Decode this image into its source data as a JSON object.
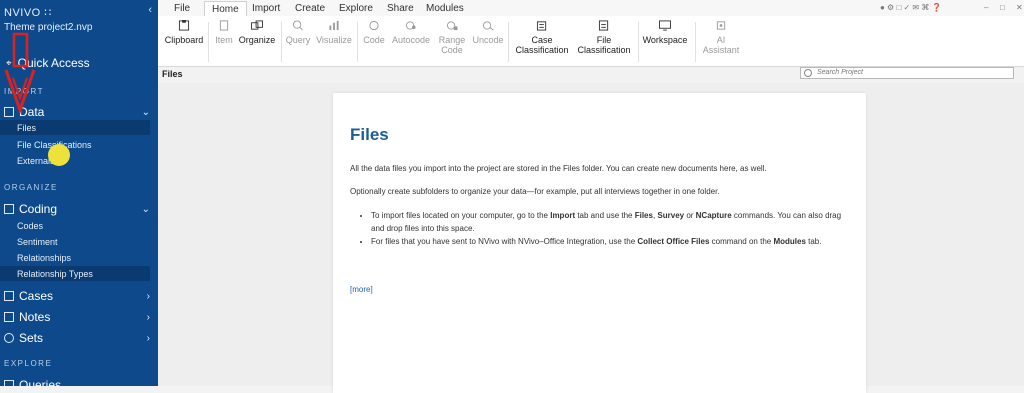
{
  "app": {
    "brand": "NVIVO",
    "project": "Theme project2.nvp"
  },
  "sidebar": {
    "quick_access": "Quick Access",
    "sections": {
      "import": "IMPORT",
      "organize": "ORGANIZE",
      "explore": "EXPLORE"
    },
    "data_group": {
      "label": "Data",
      "items": [
        {
          "label": "Files",
          "active": true
        },
        {
          "label": "File Classifications"
        },
        {
          "label": "Externals"
        }
      ]
    },
    "coding_group": {
      "label": "Coding",
      "items": [
        {
          "label": "Codes"
        },
        {
          "label": "Sentiment"
        },
        {
          "label": "Relationships"
        },
        {
          "label": "Relationship Types"
        }
      ]
    },
    "cases": "Cases",
    "notes": "Notes",
    "sets": "Sets",
    "queries": "Queries"
  },
  "ribbon": {
    "tabs": [
      "File",
      "Home",
      "Import",
      "Create",
      "Explore",
      "Share",
      "Modules"
    ],
    "active_tab": "Home",
    "buttons": {
      "clipboard": "Clipboard",
      "item": "Item",
      "organize": "Organize",
      "query": "Query",
      "visualize": "Visualize",
      "code": "Code",
      "autocode": "Autocode",
      "range_code": [
        "Range",
        "Code"
      ],
      "uncode": "Uncode",
      "case_classification": [
        "Case",
        "Classification"
      ],
      "file_classification": [
        "File",
        "Classification"
      ],
      "workspace": "Workspace",
      "ai_assistant": [
        "AI",
        "Assistant"
      ]
    }
  },
  "header": {
    "title": "Files",
    "search_placeholder": "Search Project"
  },
  "content": {
    "title": "Files",
    "para1": "All the data files you import into the project are stored in the Files folder. You can create new documents here, as well.",
    "para2": "Optionally create subfolders to organize your data—for example, put all interviews together in one folder.",
    "bullet1": {
      "t1": "To import files located on your computer, go to the ",
      "b1": "Import",
      "t2": " tab and use the ",
      "b2": "Files",
      "t3": ", ",
      "b3": "Survey",
      "t4": " or ",
      "b4": "NCapture",
      "t5": " commands. You can also drag and drop files into this space."
    },
    "bullet2": {
      "t1": "For files that you have sent to NVivo with NVivo–Office Integration, use the ",
      "b1": "Collect Office Files",
      "t2": " command on the ",
      "b2": "Modules",
      "t3": " tab."
    },
    "more": "[more]"
  },
  "colors": {
    "sidebar": "#0e4a8b",
    "title": "#1b5e96",
    "annotation_arrow": "#e0201b",
    "highlight": "#ede13a"
  }
}
